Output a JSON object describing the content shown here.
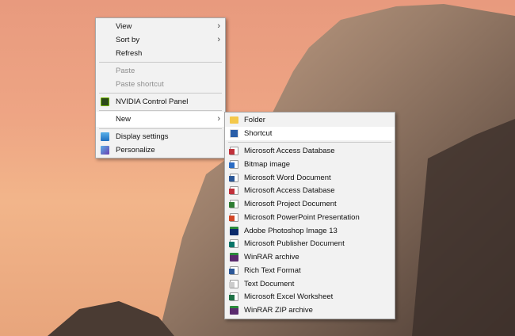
{
  "context_menu": {
    "items": [
      {
        "label": "View",
        "submenu": true
      },
      {
        "label": "Sort by",
        "submenu": true
      },
      {
        "label": "Refresh"
      },
      {
        "label": "Paste",
        "disabled": true
      },
      {
        "label": "Paste shortcut",
        "disabled": true
      },
      {
        "label": "NVIDIA Control Panel",
        "icon": "nvidia-icon"
      },
      {
        "label": "New",
        "submenu": true,
        "highlighted": true
      },
      {
        "label": "Display settings",
        "icon": "display-icon"
      },
      {
        "label": "Personalize",
        "icon": "personalize-icon"
      }
    ]
  },
  "new_submenu": {
    "items": [
      {
        "label": "Folder",
        "icon": "folder-icon"
      },
      {
        "label": "Shortcut",
        "icon": "shortcut-icon",
        "highlighted": true
      },
      {
        "label": "Microsoft Access Database",
        "icon": "access-icon",
        "color": "#c0303a"
      },
      {
        "label": "Bitmap image",
        "icon": "bitmap-icon",
        "color": "#2b6cc4"
      },
      {
        "label": "Microsoft Word Document",
        "icon": "word-icon",
        "color": "#2b5797"
      },
      {
        "label": "Microsoft Access Database",
        "icon": "access-icon",
        "color": "#c0303a"
      },
      {
        "label": "Microsoft Project Document",
        "icon": "project-icon",
        "color": "#2e7d32"
      },
      {
        "label": "Microsoft PowerPoint Presentation",
        "icon": "powerpoint-icon",
        "color": "#d24726"
      },
      {
        "label": "Adobe Photoshop Image 13",
        "icon": "photoshop-icon",
        "color": "#0a2a6b"
      },
      {
        "label": "Microsoft Publisher Document",
        "icon": "publisher-icon",
        "color": "#077568"
      },
      {
        "label": "WinRAR archive",
        "icon": "winrar-icon",
        "color": "#5a2a6e"
      },
      {
        "label": "Rich Text Format",
        "icon": "rtf-icon",
        "color": "#2b5797"
      },
      {
        "label": "Text Document",
        "icon": "text-icon",
        "color": "#cccccc"
      },
      {
        "label": "Microsoft Excel Worksheet",
        "icon": "excel-icon",
        "color": "#1e7145"
      },
      {
        "label": "WinRAR ZIP archive",
        "icon": "winrar-zip-icon",
        "color": "#5a2a6e"
      }
    ]
  }
}
